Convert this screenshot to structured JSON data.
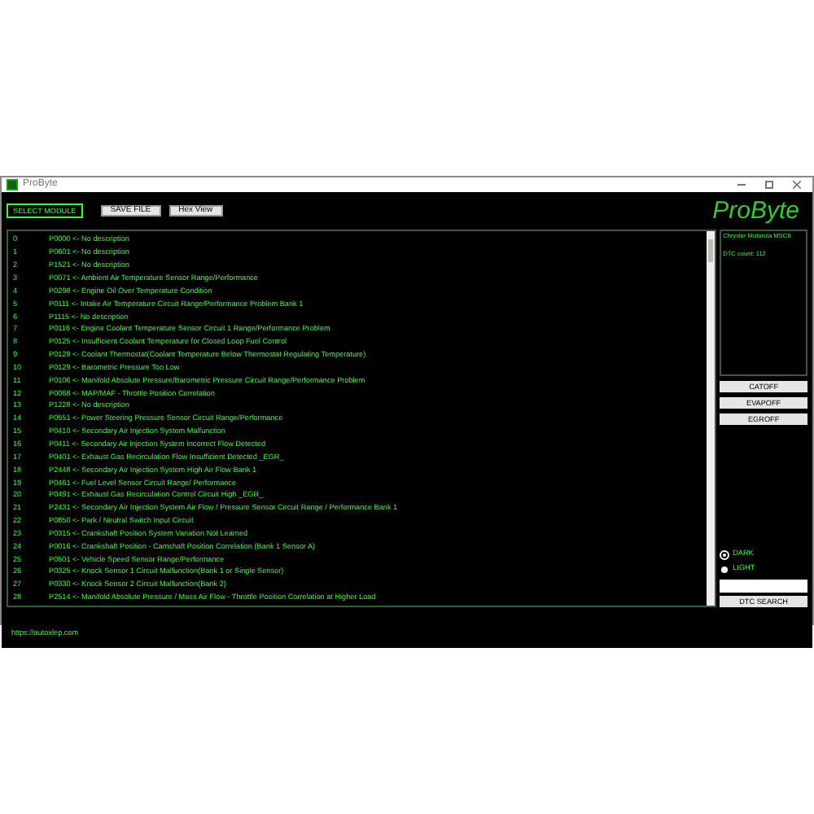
{
  "window": {
    "title": "ProByte"
  },
  "toolbar": {
    "buttons": [
      {
        "label": "SELECT MODULE",
        "kind": "outline"
      },
      {
        "label": "SAVE FILE",
        "kind": "plain"
      },
      {
        "label": "Hex View",
        "kind": "plain"
      }
    ]
  },
  "logo": "ProByte",
  "dtc_list": [
    {
      "index": "0",
      "text": "P0000 <- No description"
    },
    {
      "index": "1",
      "text": "P0601 <- No description"
    },
    {
      "index": "2",
      "text": "P1521 <- No description"
    },
    {
      "index": "3",
      "text": "P0071 <- Ambient Air Temperature Sensor Range/Performance"
    },
    {
      "index": "4",
      "text": "P0298 <- Engine Oil Over Temperature Condition"
    },
    {
      "index": "5",
      "text": "P0111 <- Intake Air Temperature Circuit Range/Performance Problem Bank 1"
    },
    {
      "index": "6",
      "text": "P1115 <- No description"
    },
    {
      "index": "7",
      "text": "P0116 <- Engine Coolant Temperature Sensor Circuit 1 Range/Performance Problem"
    },
    {
      "index": "8",
      "text": "P0125 <- Insufficient Coolant Temperature for Closed Loop Fuel Control"
    },
    {
      "index": "9",
      "text": "P0128 <- Coolant Thermostat(Coolant Temperature Below Thermostat Regulating Temperature)"
    },
    {
      "index": "10",
      "text": "P0129 <- Barometric Pressure Too Low"
    },
    {
      "index": "11",
      "text": "P0106 <- Manifold Absolute Pressure/Barometric Pressure Circuit Range/Performance Problem"
    },
    {
      "index": "12",
      "text": "P0068 <- MAP/MAF - Throttle Position Correlation"
    },
    {
      "index": "13",
      "text": "P1228 <- No description"
    },
    {
      "index": "14",
      "text": "P0551 <- Power Steering Pressure Sensor Circuit Range/Performance"
    },
    {
      "index": "15",
      "text": "P0410 <- Secondary Air Injection System Malfunction"
    },
    {
      "index": "16",
      "text": "P0411 <- Secondary Air Injection System Incorrect Flow Detected"
    },
    {
      "index": "17",
      "text": "P0401 <- Exhaust Gas Recirculation Flow Insufficient Detected _EGR_"
    },
    {
      "index": "18",
      "text": "P2448 <- Secondary Air Injection System High Air Flow Bank 1"
    },
    {
      "index": "19",
      "text": "P0461 <- Fuel Level Sensor Circuit Range/ Performance"
    },
    {
      "index": "20",
      "text": "P0491 <- Exhaust Gas Recirculation Control Circuit High _EGR_"
    },
    {
      "index": "21",
      "text": "P2431 <- Secondary Air Injection System Air Flow / Pressure Sensor Circuit Range / Performance Bank 1"
    },
    {
      "index": "22",
      "text": "P0850 <- Park / Neutral Switch Input Circuit"
    },
    {
      "index": "23",
      "text": "P0315 <- Crankshaft Position System Variation Not Learned"
    },
    {
      "index": "24",
      "text": "P0016 <- Crankshaft Position - Camshaft Position Correlation (Bank 1 Sensor A)"
    },
    {
      "index": "25",
      "text": "P0501 <- Vehicle Speed Sensor Range/Performance"
    },
    {
      "index": "26",
      "text": "P0325 <- Knock Sensor 1 Circuit Malfunction(Bank 1 or Single Sensor)"
    },
    {
      "index": "27",
      "text": "P0330 <- Knock Sensor 2 Circuit Malfunction(Bank 2)"
    },
    {
      "index": "28",
      "text": "P2514 <- Manifold Absolute Pressure / Mass Air Flow - Throttle Position Correlation at Higher Load"
    }
  ],
  "info": [
    "Chrysler Motorola MSCII",
    "DTC count: 112"
  ],
  "actions": [
    "CATOFF",
    "EVAPOFF",
    "EGROFF"
  ],
  "theme": [
    {
      "label": "DARK",
      "selected": true
    },
    {
      "label": "LIGHT",
      "selected": false
    }
  ],
  "search_button": "DTC SEARCH",
  "status_bar": "https://autoxlep.com"
}
